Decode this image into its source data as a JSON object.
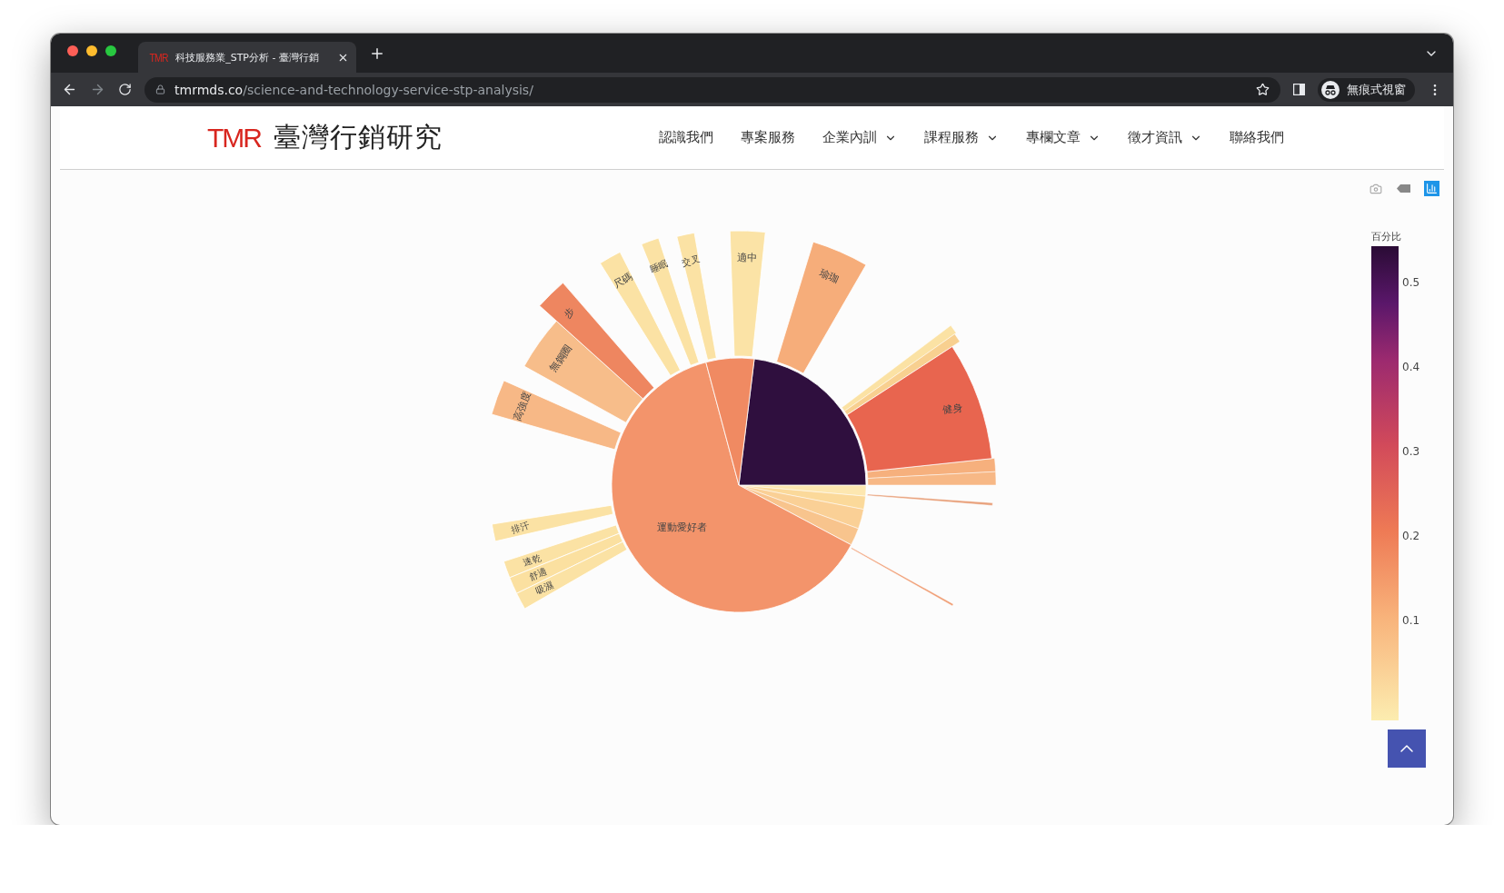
{
  "browser": {
    "favicon_mark": "TMR",
    "tab_title": "科技服務業_STP分析 - 臺灣行銷",
    "url_host": "tmrmds.co",
    "url_path": "/science-and-technology-service-stp-analysis/",
    "profile_label": "無痕式視窗"
  },
  "site": {
    "logo_mark": "TMR",
    "logo_text": "臺灣行銷研究",
    "nav": [
      {
        "label": "認識我們",
        "dropdown": false
      },
      {
        "label": "專案服務",
        "dropdown": false
      },
      {
        "label": "企業內訓",
        "dropdown": true
      },
      {
        "label": "課程服務",
        "dropdown": true
      },
      {
        "label": "專欄文章",
        "dropdown": true
      },
      {
        "label": "徵才資訊",
        "dropdown": true
      },
      {
        "label": "聯絡我們",
        "dropdown": false
      }
    ]
  },
  "modebar": [
    {
      "kind": "camera",
      "selected": false
    },
    {
      "kind": "tag",
      "selected": false
    },
    {
      "kind": "bars",
      "selected": true
    }
  ],
  "sunburst": {
    "inner": [
      {
        "color": "#2f0f3e"
      },
      {
        "label": "運動愛好者",
        "color": "#f3946b"
      },
      {
        "color": "#f08a62"
      }
    ],
    "outer": [
      {
        "label": "適中",
        "color": "#fbe3a6"
      },
      {
        "label": "瑜珈",
        "color": "#f6ad7a"
      },
      {
        "label": "健身",
        "color": "#e8654f"
      },
      {
        "label": "高強度",
        "color": "#f7b886"
      },
      {
        "label": "無鋼圈",
        "color": "#f7bd8a"
      },
      {
        "label": "步",
        "color": "#ee8660"
      },
      {
        "label": "尺碼",
        "color": "#fbe2a4"
      },
      {
        "label": "睡眠",
        "color": "#fbe2a4"
      },
      {
        "label": "交叉",
        "color": "#fbe2a4"
      },
      {
        "label": "排汗",
        "color": "#fbe2a4"
      },
      {
        "label": "速乾",
        "color": "#fbe2a4"
      },
      {
        "label": "舒適",
        "color": "#fbe0a0"
      },
      {
        "label": "吸濕",
        "color": "#fbe2a4"
      }
    ]
  },
  "colorbar": {
    "title": "百分比",
    "ticks": [
      "0.5",
      "0.4",
      "0.3",
      "0.2",
      "0.1"
    ]
  }
}
